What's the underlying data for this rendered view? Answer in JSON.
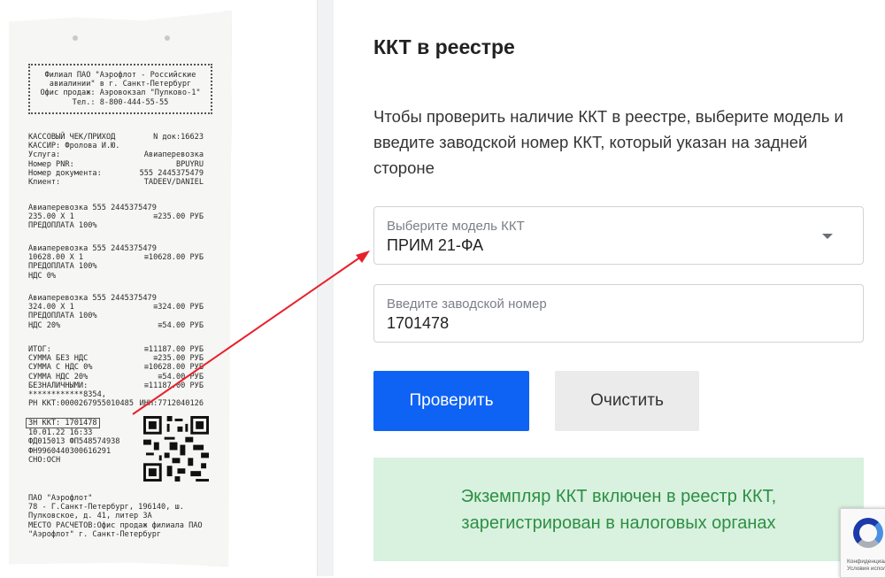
{
  "receipt": {
    "header_lines": "Филиал ПАО \"Аэрофлот - Российские\nавиалинии\" в г. Санкт-Петербург\nОфис продаж: Аэровокзал \"Пулково-1\"\nТел.: 8-800-444-55-55",
    "doc_title": "КАССОВЫЙ ЧЕК/ПРИХОД",
    "doc_number": "N док:16623",
    "cashier": "КАССИР: Фролова И.Ю.",
    "service_label": "Услуга:",
    "service_value": "Авиаперевозка",
    "pnr_label": "Номер PNR:",
    "pnr_value": "BPUYRU",
    "docno_label": "Номер документа:",
    "docno_value": "555 2445375479",
    "client_label": "Клиент:",
    "client_value": "TADEEV/DANIEL",
    "item1_name": "Авиаперевозка 555 2445375479",
    "item1_qty": "235.00 X 1",
    "item1_sum": "≡235.00 РУБ",
    "item1_prepay": "ПРЕДОПЛАТА 100%",
    "item2_name": "Авиаперевозка 555 2445375479",
    "item2_qty": "10628.00 X 1",
    "item2_sum": "≡10628.00 РУБ",
    "item2_prepay": "ПРЕДОПЛАТА 100%",
    "item2_vat": "НДС 0%",
    "item3_name": "Авиаперевозка 555 2445375479",
    "item3_qty": "324.00 X 1",
    "item3_sum": "≡324.00 РУБ",
    "item3_prepay": "ПРЕДОПЛАТА 100%",
    "item3_vat": "НДС 20%",
    "item3_vat_sum": "≡54.00 РУБ",
    "total_label": "ИТОГ:",
    "total_value": "≡11187.00 РУБ",
    "novat_label": "СУММА БЕЗ НДС",
    "novat_value": "≡235.00 РУБ",
    "vat0_label": "СУММА С НДС 0%",
    "vat0_value": "≡10628.00 РУБ",
    "vat20_label": "СУММА НДС 20%",
    "vat20_value": "≡54.00 РУБ",
    "cashless_label": "БЕЗНАЛИЧНЫМИ:",
    "cashless_value": "≡11187.00 РУБ",
    "card": "************8354,",
    "rn_kkt": "РН ККТ:0000267955010485",
    "inn": "ИНН:7712040126",
    "zn_kkt": "ЗН ККТ: 1701478",
    "datetime": "10.01.22 16:33",
    "fd": "ФД015013 ФП548574938",
    "fn": "ФН9960440300616291",
    "sno": "СНО:ОСН",
    "footer_org": "ПАО \"Аэрофлот\"",
    "footer_addr1": "78 - Г.Санкт-Петербург, 196140, ш.",
    "footer_addr2": "Пулковское, д. 41, литер 3А",
    "footer_place": "МЕСТО РАСЧЕТОВ:Офис продаж филиала ПАО",
    "footer_place2": "\"Аэрофлот\" г. Санкт-Петербург"
  },
  "form": {
    "title": "ККТ в реестре",
    "lead": "Чтобы проверить наличие ККТ в реестре, выберите модель и введите заводской номер ККТ, который указан на задней стороне",
    "model_label": "Выберите модель ККТ",
    "model_value": "ПРИМ 21-ФА",
    "serial_label": "Введите заводской номер",
    "serial_value": "1701478",
    "check_button": "Проверить",
    "clear_button": "Очистить",
    "result_text": "Экземпляр ККТ включен в реестр ККТ, зарегистрирован в налоговых органах"
  },
  "captcha": {
    "line1": "Конфиденциальн",
    "line2": "Условия испол"
  },
  "colors": {
    "primary_button": "#0e63f4",
    "result_bg": "#d9f1df",
    "result_text": "#2d8f44",
    "arrow": "#e8202a"
  }
}
